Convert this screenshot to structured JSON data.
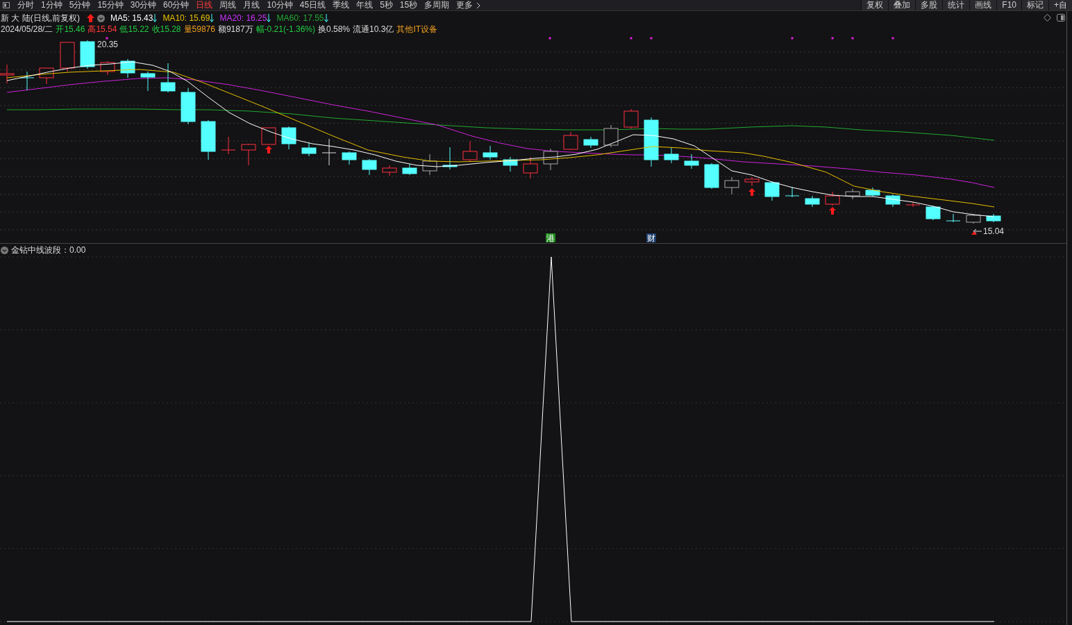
{
  "toolbar": {
    "periods": [
      {
        "label": "分时",
        "selected": false
      },
      {
        "label": "1分钟",
        "selected": false
      },
      {
        "label": "5分钟",
        "selected": false
      },
      {
        "label": "15分钟",
        "selected": false
      },
      {
        "label": "30分钟",
        "selected": false
      },
      {
        "label": "60分钟",
        "selected": false
      },
      {
        "label": "日线",
        "selected": true
      },
      {
        "label": "周线",
        "selected": false
      },
      {
        "label": "月线",
        "selected": false
      },
      {
        "label": "10分钟",
        "selected": false
      },
      {
        "label": "45日线",
        "selected": false
      },
      {
        "label": "季线",
        "selected": false
      },
      {
        "label": "年线",
        "selected": false
      },
      {
        "label": "5秒",
        "selected": false
      },
      {
        "label": "15秒",
        "selected": false
      },
      {
        "label": "多周期",
        "selected": false
      }
    ],
    "more": "更多",
    "actions": [
      "复权",
      "叠加",
      "多股",
      "统计",
      "画线",
      "F10",
      "标记",
      "+自"
    ]
  },
  "chart": {
    "title": "新 大 陆(日线,前复权)",
    "averages": [
      {
        "label": "MA5: 15.43",
        "color": "#ffffff"
      },
      {
        "label": "MA10: 15.69",
        "color": "#e6c000"
      },
      {
        "label": "MA20: 16.25",
        "color": "#cc33ff"
      },
      {
        "label": "MA60: 17.55",
        "color": "#22aa33"
      }
    ],
    "date": "2024/05/28/二",
    "quote": [
      {
        "text": "开15.46",
        "color": "#22cc44"
      },
      {
        "text": "高15.54",
        "color": "#ff3b3b"
      },
      {
        "text": "低15.22",
        "color": "#22cc44"
      },
      {
        "text": "收15.28",
        "color": "#22cc44"
      },
      {
        "text": "量59876",
        "color": "#f0a020"
      },
      {
        "text": "额9187万",
        "color": "#dddddd"
      },
      {
        "text": "幅-0.21(-1.36%)",
        "color": "#22cc44"
      },
      {
        "text": "换0.58%",
        "color": "#dddddd"
      },
      {
        "text": "流通10.3亿",
        "color": "#dddddd"
      },
      {
        "text": "其他IT设备",
        "color": "#f0a020"
      }
    ],
    "high_label": "20.35",
    "low_label": "15.04",
    "markers": [
      {
        "text": "港",
        "color": "#1e8a1e"
      },
      {
        "text": "财",
        "color": "#1a3a6a"
      }
    ]
  },
  "indicator": {
    "title": "金钻中线波段：0.00"
  }
}
